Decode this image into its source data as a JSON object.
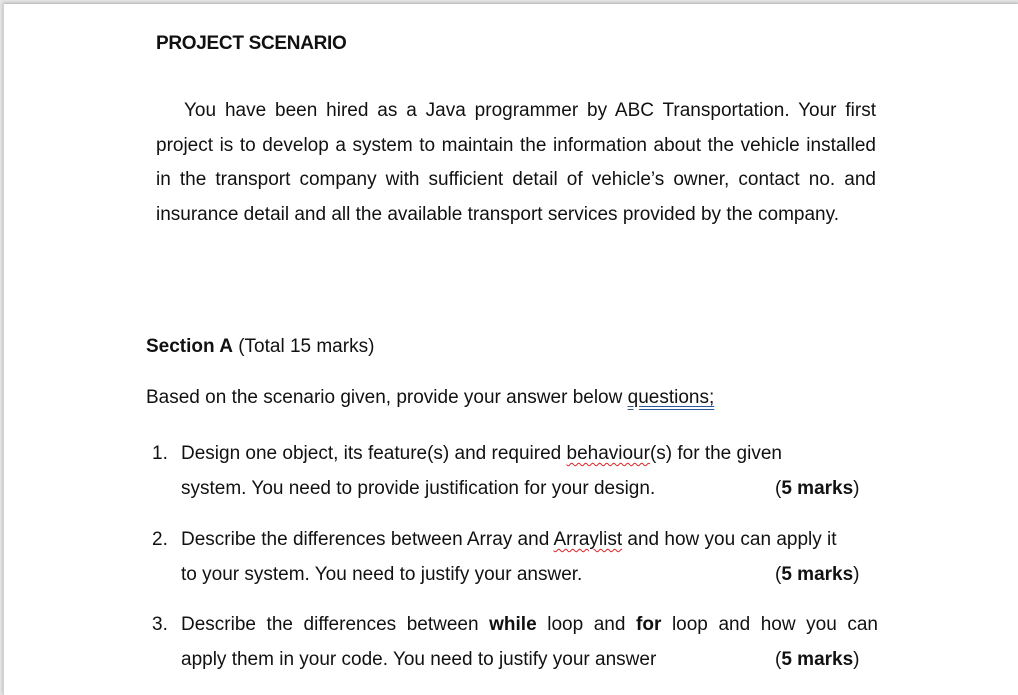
{
  "document": {
    "heading": "PROJECT SCENARIO",
    "scenario_paragraph": "You have been hired as a Java programmer by ABC Transportation. Your first project is to develop a system to maintain the information about the vehicle installed in the transport company with sufficient detail of vehicle’s owner, contact no. and insurance detail and all the available transport services provided by the company.",
    "section": {
      "label": "Section A",
      "total": "(Total 15 marks)"
    },
    "intro": {
      "text": "Based on the scenario given, provide your answer below ",
      "underlined": "questions;"
    },
    "questions": [
      {
        "number": "1.",
        "line1_pre": "Design one object, its feature(s) and required ",
        "line1_misspelled": "behaviour",
        "line1_post": "(s) for the given",
        "line2": "system. You need to provide justification for your design.",
        "marks": "5 marks"
      },
      {
        "number": "2.",
        "line1_pre": "Describe the differences between Array and ",
        "line1_misspelled": "Arraylist",
        "line1_post": " and how you can apply it",
        "line2": "to your system. You need to justify your answer.",
        "marks": "5 marks"
      },
      {
        "number": "3.",
        "line1_a": "Describe the differences between ",
        "line1_bold1": "while",
        "line1_b": " loop and ",
        "line1_bold2": "for",
        "line1_c": " loop and how you can",
        "line2": "apply them in your code. You need to justify your answer",
        "marks": "5 marks"
      }
    ]
  }
}
